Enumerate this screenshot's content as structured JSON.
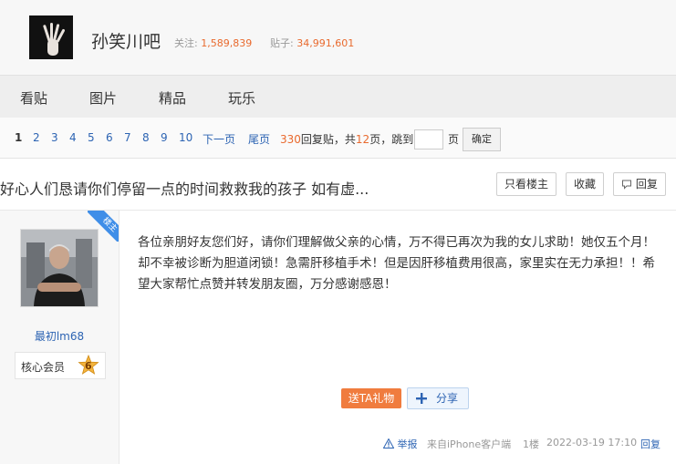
{
  "forum": {
    "name": "孙笑川吧",
    "follow_label": "关注:",
    "follow_count": "1,589,839",
    "posts_label": "贴子:",
    "posts_count": "34,991,601"
  },
  "nav": {
    "items": [
      "看贴",
      "图片",
      "精品",
      "玩乐"
    ]
  },
  "pager": {
    "pages": [
      "1",
      "2",
      "3",
      "4",
      "5",
      "6",
      "7",
      "8",
      "9",
      "10"
    ],
    "current": "1",
    "next": "下一页",
    "last": "尾页",
    "reply_count": "330",
    "reply_label": "回复贴，共",
    "total_pages": "12",
    "pages_suffix": "页，",
    "jump_label": "跳到",
    "page_unit": "页",
    "confirm": "确定"
  },
  "thread": {
    "title": "好心人们恳请你们停留一点的时间救救我的孩子 如有虚...",
    "only_op": "只看楼主",
    "favorite": "收藏",
    "reply": "回复"
  },
  "post": {
    "op_badge": "楼主",
    "username": "最初lm68",
    "member_label": "核心会员",
    "level": "6",
    "content": "各位亲朋好友您们好，请你们理解做父亲的心情，万不得已再次为我的女儿求助！她仅五个月！却不幸被诊断为胆道闭锁！急需肝移植手术！但是因肝移植费用很高，家里实在无力承担！！希望大家帮忙点赞并转发朋友圈，万分感谢感恩！",
    "gift_button": "送TA礼物",
    "share_button": "分享",
    "report": "举报",
    "source": "来自iPhone客户端",
    "floor": "1楼",
    "time": "2022-03-19 17:10",
    "reply": "回复"
  },
  "colors": {
    "accent": "#e96a2e",
    "link": "#2d64b3",
    "badge_blue": "#3f8ee8"
  }
}
